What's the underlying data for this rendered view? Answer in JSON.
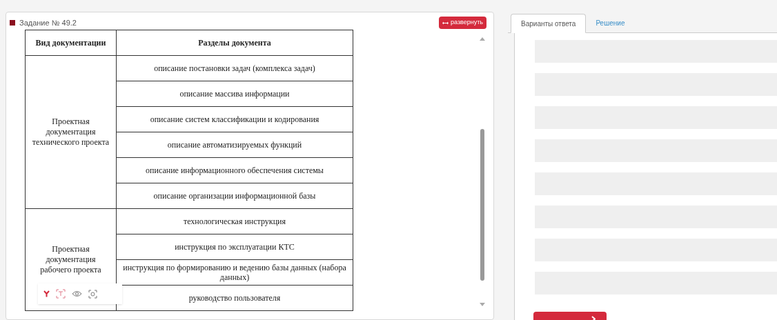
{
  "task": {
    "title": "Задание № 49.2",
    "expand_button": "развернуть"
  },
  "table": {
    "columns": [
      "Вид документации",
      "Разделы документа"
    ],
    "groups": [
      {
        "type": "Проектная документация технического проекта",
        "sections": [
          "описание постановки задач (комплекса задач)",
          "описание массива информации",
          "описание систем классификации и кодирования",
          "описание автоматизируемых функций",
          "описание информационного обеспечения системы",
          "описание организации информационной базы"
        ]
      },
      {
        "type": "Проектная документация рабочего проекта",
        "sections": [
          "технологическая инструкция",
          "инструкция по эксплуатации КТС",
          "инструкция по формированию и ведению базы данных (набора данных)",
          "руководство пользователя"
        ]
      }
    ]
  },
  "tabs": [
    {
      "label": "Варианты ответа",
      "selected": true
    },
    {
      "label": "Решение",
      "selected": false
    }
  ]
}
